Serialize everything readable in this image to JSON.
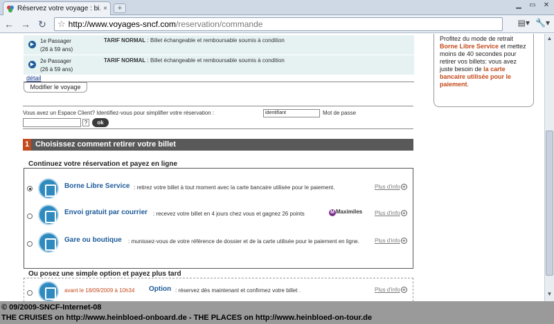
{
  "browser": {
    "tab_title": "Réservez votre voyage : bi...",
    "tab_close": "×",
    "new_tab": "+",
    "url_domain": "http://www.voyages-sncf.com",
    "url_path": "/reservation/commande"
  },
  "passengers": [
    {
      "name": "1e Passager",
      "age": "(26 à 59 ans)",
      "tarif": "TARIF NORMAL",
      "tarif_desc": " : Billet échangeable et remboursable soumis à condition"
    },
    {
      "name": "2e Passager",
      "age": "(26 à 59 ans)",
      "tarif": "TARIF NORMAL",
      "tarif_desc": " : Billet échangeable et remboursable soumis à condition"
    }
  ],
  "detail_link": "détail",
  "modify_button": "Modifier le voyage",
  "client": {
    "prompt": "Vous avez un Espace Client? Identifiez-vous pour simplifier votre réservation :",
    "identifiant_value": "identifiant",
    "password_label": "Mot de passe",
    "help_label": "?",
    "ok_label": "ok"
  },
  "section": {
    "number": "1",
    "title": "Choisissez comment retirer votre billet"
  },
  "online": {
    "heading": "Continuez votre réservation et payez en ligne",
    "options": [
      {
        "title": "Borne Libre Service",
        "desc": " : retirez votre billet à tout moment avec la carte bancaire utilisée pour le paiement.",
        "more": "Plus d'info",
        "checked": true
      },
      {
        "title": "Envoi gratuit par courrier",
        "desc": " : recevez votre billet en 4 jours chez vous et gagnez 26 points",
        "more": "Plus d'info",
        "checked": false,
        "badge": "Maximiles"
      },
      {
        "title": "Gare ou boutique",
        "desc": " : munissez-vous de votre référence de dossier et de la carte utilisée pour le paiement en ligne.",
        "more": "Plus d'info",
        "checked": false
      }
    ]
  },
  "later": {
    "heading": "Ou posez une simple option et payez plus tard",
    "date": "avant le 18/09/2009 à 10h34",
    "title": "Option",
    "desc": " : réservez dès maintenant et confirmez votre billet .",
    "more": "Plus d'info"
  },
  "sidebar": {
    "text_1": "Profitez du mode de retrait",
    "hl_1": "Borne Libre Service",
    "text_2": "et mettez moins de 40 secondes pour retirer vos billets: vous avez juste besoin de",
    "hl_2": "la carte bancaire utilisée pour le paiement",
    "text_3": "."
  },
  "caption": {
    "line1": "© 09/2009-SNCF-Internet-08",
    "line2": "THE CRUISES on http://www.heinbloed-onboard.de - THE PLACES on http://www.heinbloed-on-tour.de"
  },
  "colors": {
    "accent": "#c44a1c",
    "link": "#1d5a9a",
    "bar": "#595959"
  }
}
